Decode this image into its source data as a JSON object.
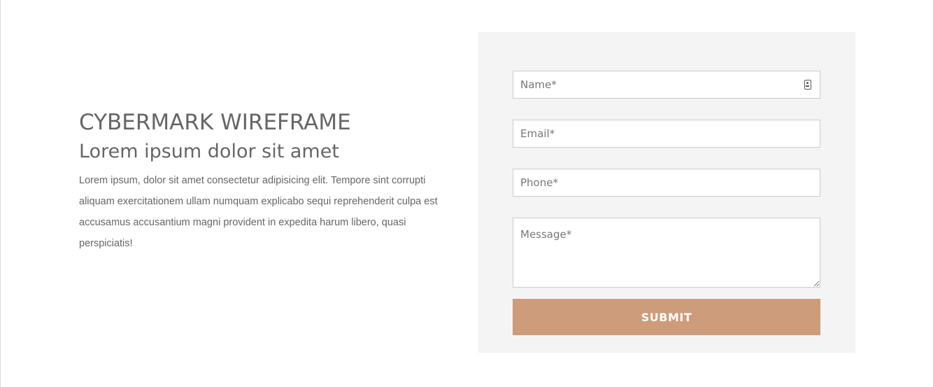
{
  "intro": {
    "title": "CYBERMARK WIREFRAME",
    "subtitle": "Lorem ipsum dolor sit amet",
    "body": "Lorem ipsum, dolor sit amet consectetur adipisicing elit. Tempore sint corrupti aliquam exercitationem ullam numquam explicabo sequi reprehenderit culpa est accusamus accusantium magni provident in expedita harum libero, quasi perspiciatis!"
  },
  "form": {
    "name": {
      "placeholder": "Name*",
      "value": ""
    },
    "email": {
      "placeholder": "Email*",
      "value": ""
    },
    "phone": {
      "placeholder": "Phone*",
      "value": ""
    },
    "message": {
      "placeholder": "Message*",
      "value": ""
    },
    "submit_label": "SUBMIT",
    "name_icon": "contact-card-icon"
  },
  "colors": {
    "panel_background": "#f4f4f4",
    "submit_button": "#cd9c7b",
    "text": "#666666"
  }
}
